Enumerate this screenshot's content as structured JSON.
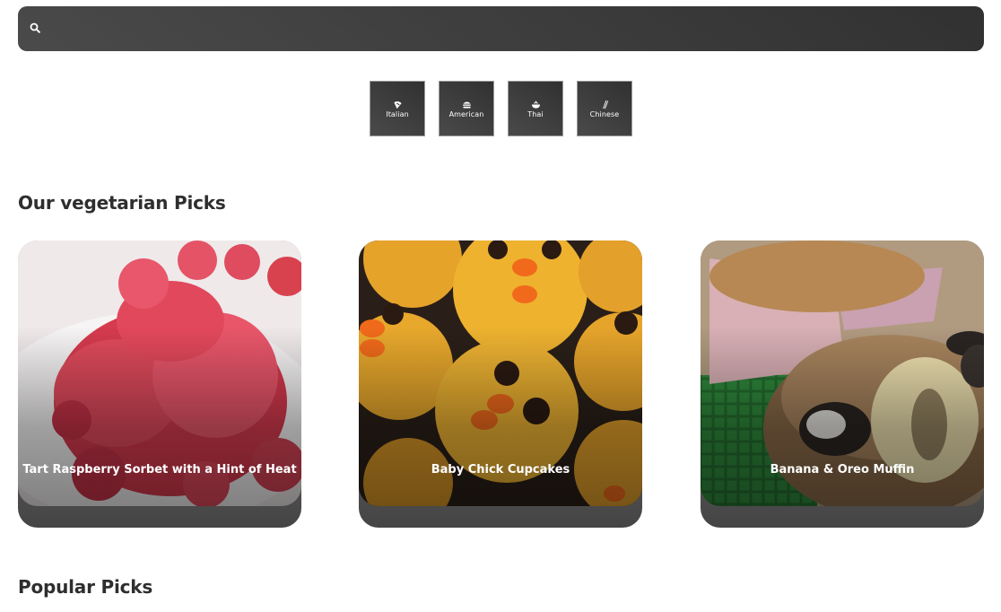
{
  "search": {
    "placeholder": ""
  },
  "cuisines": [
    {
      "label": "Italian",
      "icon": "pizza-icon"
    },
    {
      "label": "American",
      "icon": "burger-icon"
    },
    {
      "label": "Thai",
      "icon": "bowl-icon"
    },
    {
      "label": "Chinese",
      "icon": "chopsticks-icon"
    }
  ],
  "sections": {
    "vegetarian_title": "Our vegetarian Picks",
    "popular_title": "Popular Picks"
  },
  "recipes": [
    {
      "title": "Tart Raspberry Sorbet with a Hint of Heat"
    },
    {
      "title": "Baby Chick Cupcakes"
    },
    {
      "title": "Banana & Oreo Muffin"
    }
  ],
  "colors": {
    "dark": "#3a3a3a",
    "accent_text": "#ffffff",
    "heading": "#2e2e2e"
  }
}
